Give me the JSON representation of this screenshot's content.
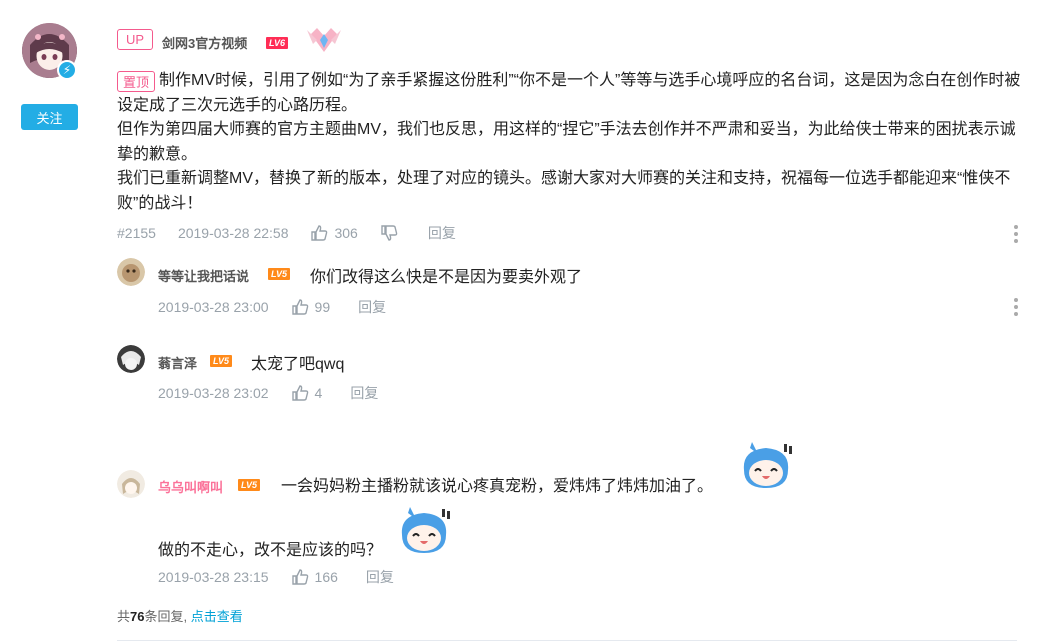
{
  "main_comment": {
    "follow_label": "关注",
    "up_tag": "UP",
    "username": "剑网3官方视频",
    "level": "LV6",
    "pin_tag": "置顶",
    "paragraphs": [
      "制作MV时候，引用了例如“为了亲手紧握这份胜利”“你不是一个人”等等与选手心境呼应的名台词，这是因为念白在创作时被设定成了三次元选手的心路历程。",
      "但作为第四届大师赛的官方主题曲MV，我们也反思，用这样的“捏它”手法去创作并不严肃和妥当，为此给侠士带来的困扰表示诚挚的歉意。",
      "我们已重新调整MV，替换了新的版本，处理了对应的镜头。感谢大家对大师赛的关注和支持，祝福每一位选手都能迎来“惟侠不败”的战斗！"
    ],
    "floor": "#2155",
    "time": "2019-03-28 22:58",
    "likes": "306",
    "reply_label": "回复"
  },
  "replies": [
    {
      "username": "等等让我把话说",
      "level": "LV5",
      "text": "你们改得这么快是不是因为要卖外观了",
      "time": "2019-03-28 23:00",
      "likes": "99",
      "reply_label": "回复"
    },
    {
      "username": "蓊言泽",
      "level": "LV5",
      "text": "太宠了吧qwq",
      "time": "2019-03-28 23:02",
      "likes": "4",
      "reply_label": "回复"
    },
    {
      "username": "乌乌叫啊叫",
      "level": "LV5",
      "text": "一会妈妈粉主播粉就该说心疼真宠粉，爱炜炜了炜炜加油了。",
      "text2": "做的不走心，改不是应该的吗？",
      "time": "2019-03-28 23:15",
      "likes": "166",
      "reply_label": "回复"
    }
  ],
  "footer": {
    "prefix": "共",
    "count": "76",
    "suffix": "条回复,",
    "view_label": "点击查看"
  },
  "colors": {
    "accent": "#23ade5",
    "pink": "#f45a8d",
    "meta": "#99a2aa",
    "link": "#00a1d6"
  }
}
